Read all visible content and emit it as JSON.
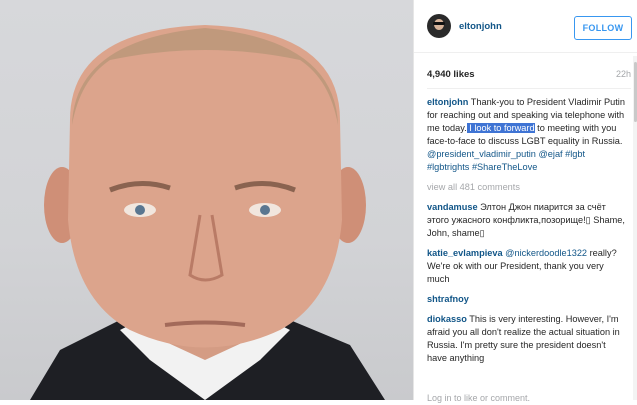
{
  "post": {
    "username": "eltonjohn",
    "follow_label": "FOLLOW",
    "likes": "4,940 likes",
    "time": "22h",
    "caption": {
      "username": "eltonjohn",
      "text_before": "Thank-you to President Vladimir Putin for reaching out and speaking via telephone with me today.",
      "highlighted": " I look to forward",
      "text_after": " to meeting with you face-to-face to discuss LGBT equality in Russia.",
      "tags": "@president_vladimir_putin @ejaf #lgbt #lgbtrights #ShareTheLove"
    },
    "view_all": "view all 481 comments",
    "comments": [
      {
        "username": "vandamuse",
        "text": "Элтон Джон пиарится за счёт этого ужасного конфликта,позорище!▯ Shame, John, shame▯"
      },
      {
        "username": "katie_evlampieva",
        "mention": "@nickerdoodle1322",
        "text": "really? We're ok with our President, thank you very much"
      },
      {
        "username": "shtrafnoy",
        "text": ""
      },
      {
        "username": "diokasso",
        "text": "This is very interesting. However, I'm afraid you all don't realize the actual situation in Russia. I'm pretty sure the president doesn't have anything"
      }
    ],
    "add_comment": "Log in to like or comment."
  },
  "colors": {
    "link": "#125688",
    "follow": "#3897f0",
    "highlight": "#3f74d4"
  },
  "icons": {
    "avatar": "profile-photo"
  }
}
